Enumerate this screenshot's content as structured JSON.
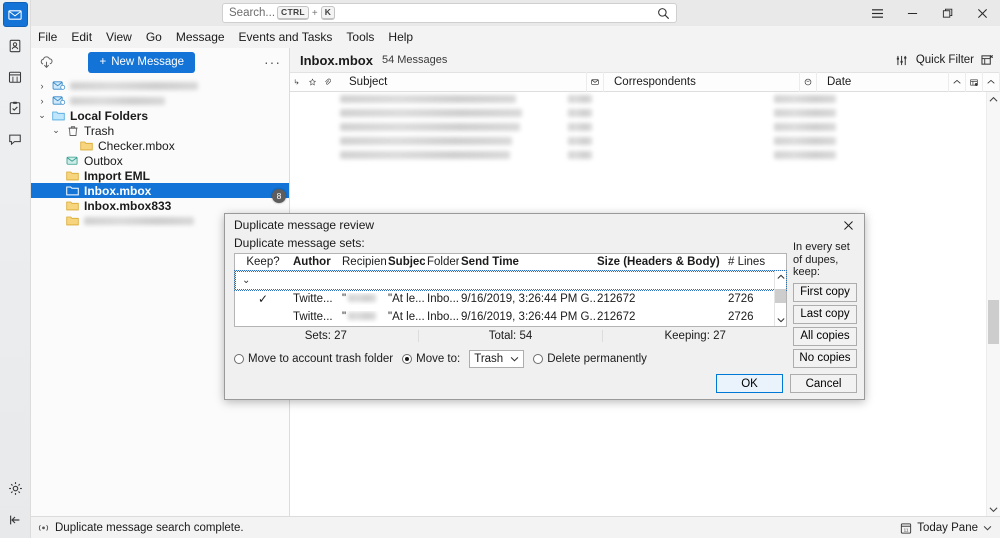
{
  "titlebar": {
    "search_placeholder": "Search...",
    "kbd_ctrl": "CTRL",
    "kbd_plus": "+",
    "kbd_k": "K"
  },
  "menubar": {
    "items": [
      {
        "label": "File"
      },
      {
        "label": "Edit"
      },
      {
        "label": "View"
      },
      {
        "label": "Go"
      },
      {
        "label": "Message"
      },
      {
        "label": "Events and Tasks"
      },
      {
        "label": "Tools"
      },
      {
        "label": "Help"
      }
    ]
  },
  "folder_pane": {
    "new_message_label": "New Message",
    "new_message_plus": "+",
    "more_dots": "···",
    "import_badge": "8",
    "items": [
      {
        "label": "",
        "blurred": true,
        "indent": 0,
        "twisty": "›",
        "icon": "account-mail-icon",
        "bold": false,
        "selected": false,
        "blur_width": 128
      },
      {
        "label": "",
        "blurred": true,
        "indent": 0,
        "twisty": "›",
        "icon": "account-mail-icon",
        "bold": false,
        "selected": false,
        "blur_width": 95
      },
      {
        "label": "Local Folders",
        "blurred": false,
        "indent": 0,
        "twisty": "⌄",
        "icon": "folder-blue-icon",
        "bold": true,
        "selected": false
      },
      {
        "label": "Trash",
        "blurred": false,
        "indent": 1,
        "twisty": "⌄",
        "icon": "trash-icon",
        "bold": false,
        "selected": false
      },
      {
        "label": "Checker.mbox",
        "blurred": false,
        "indent": 2,
        "twisty": "",
        "icon": "folder-yellow-icon",
        "bold": false,
        "selected": false
      },
      {
        "label": "Outbox",
        "blurred": false,
        "indent": 1,
        "twisty": "",
        "icon": "outbox-icon",
        "bold": false,
        "selected": false
      },
      {
        "label": "Import EML",
        "blurred": false,
        "indent": 1,
        "twisty": "",
        "icon": "folder-yellow-icon",
        "bold": true,
        "selected": false
      },
      {
        "label": "Inbox.mbox",
        "blurred": false,
        "indent": 1,
        "twisty": "",
        "icon": "folder-white-icon",
        "bold": true,
        "selected": true
      },
      {
        "label": "Inbox.mbox833",
        "blurred": false,
        "indent": 1,
        "twisty": "",
        "icon": "folder-yellow-icon",
        "bold": true,
        "selected": false
      },
      {
        "label": "",
        "blurred": true,
        "indent": 1,
        "twisty": "",
        "icon": "folder-yellow-icon",
        "bold": false,
        "selected": false,
        "blur_width": 110
      }
    ]
  },
  "message_pane": {
    "folder_title": "Inbox.mbox",
    "message_count": "54 Messages",
    "quick_filter_label": "Quick Filter",
    "columns": {
      "subject": "Subject",
      "correspondents": "Correspondents",
      "date": "Date"
    },
    "rows": [
      {
        "subject_w": 176,
        "corr_w": 24,
        "date_w": 62
      },
      {
        "subject_w": 182,
        "corr_w": 24,
        "date_w": 62
      },
      {
        "subject_w": 180,
        "corr_w": 24,
        "date_w": 62
      },
      {
        "subject_w": 172,
        "corr_w": 24,
        "date_w": 62
      },
      {
        "subject_w": 170,
        "corr_w": 24,
        "date_w": 62
      }
    ]
  },
  "dialog": {
    "title": "Duplicate message review",
    "subtitle": "Duplicate message sets:",
    "columns": [
      {
        "label": "Keep?",
        "bold": false,
        "key": "keep"
      },
      {
        "label": "Author",
        "bold": true,
        "key": "author"
      },
      {
        "label": "Recipients",
        "bold": false,
        "key": "recipients"
      },
      {
        "label": "Subject",
        "bold": true,
        "key": "subject"
      },
      {
        "label": "Folder",
        "bold": false,
        "key": "folder"
      },
      {
        "label": "Send Time",
        "bold": true,
        "key": "send_time"
      },
      {
        "label": "Size (Headers & Body)",
        "bold": true,
        "key": "size"
      },
      {
        "label": "# Lines",
        "bold": false,
        "key": "lines"
      }
    ],
    "set_row_twisty": "⌄",
    "rows": [
      {
        "keep": "✓",
        "author": "Twitte...",
        "recipients": "\"",
        "subject": "\"At le...",
        "folder": "Inbo...",
        "send_time": "9/16/2019, 3:26:44 PM G...",
        "size": "212672",
        "lines": "2726"
      },
      {
        "keep": "",
        "author": "Twitte...",
        "recipients": "\"",
        "subject": "\"At le...",
        "folder": "Inbo...",
        "send_time": "9/16/2019, 3:26:44 PM G...",
        "size": "212672",
        "lines": "2726"
      }
    ],
    "totals": {
      "sets": "Sets: 27",
      "total": "Total: 54",
      "keeping": "Keeping: 27"
    },
    "options": {
      "move_to_account_trash": "Move to account trash folder",
      "move_to": "Move to:",
      "move_to_selected": "Trash",
      "delete_permanently": "Delete permanently",
      "selected": "move_to"
    },
    "keep_hint": "In every set of dupes, keep:",
    "keep_buttons": [
      {
        "label": "First copy"
      },
      {
        "label": "Last copy"
      },
      {
        "label": "All copies"
      },
      {
        "label": "No copies"
      }
    ],
    "ok_label": "OK",
    "cancel_label": "Cancel"
  },
  "statusbar": {
    "message": "Duplicate message search complete.",
    "today_pane": "Today Pane"
  },
  "colors": {
    "accent": "#1373d6",
    "selection": "#1373d6",
    "window_bg": "#f3f3f3",
    "dialog_bg": "#f0f0f0",
    "folder_yellow": "#f2c14b",
    "folder_blue": "#50b4e8",
    "primary_button_border": "#0078d7"
  }
}
